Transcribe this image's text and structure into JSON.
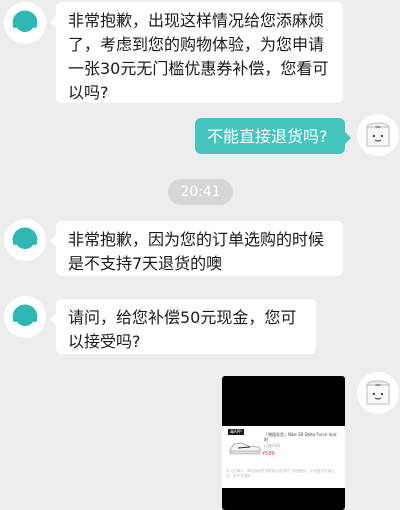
{
  "messages": {
    "m1": "非常抱歉，出现这样情况给您添麻烦了，考虑到您的购物体验，为您申请一张30元无门槛优惠券补偿，您看可以吗?",
    "m2": "不能直接退货吗?",
    "m3": "非常抱歉，因为您的订单选购的时候是不支持7天退货的噢",
    "m4": "请问，给您补偿50元现金，您可以接受吗?"
  },
  "timestamp": "20:41",
  "product_card": {
    "title": "「增值发货」Nike SB Delta Force Vulc 耐",
    "subtitle": "已选尺码",
    "price": "¥589",
    "note": "本人已确认，寄回商品时须附送与发货时一致的配件，平台鉴定不通过的，将不予退款",
    "badge": "毒APP"
  },
  "icons": {
    "agent_avatar": "service-agent-avatar-icon",
    "user_avatar": "toilet-paper-roll-avatar-icon",
    "product_image": "sneaker-icon"
  },
  "colors": {
    "background": "#ededed",
    "outgoing_bubble": "#46c4be",
    "incoming_bubble": "#ffffff",
    "time_pill": "#d6d6d6"
  }
}
